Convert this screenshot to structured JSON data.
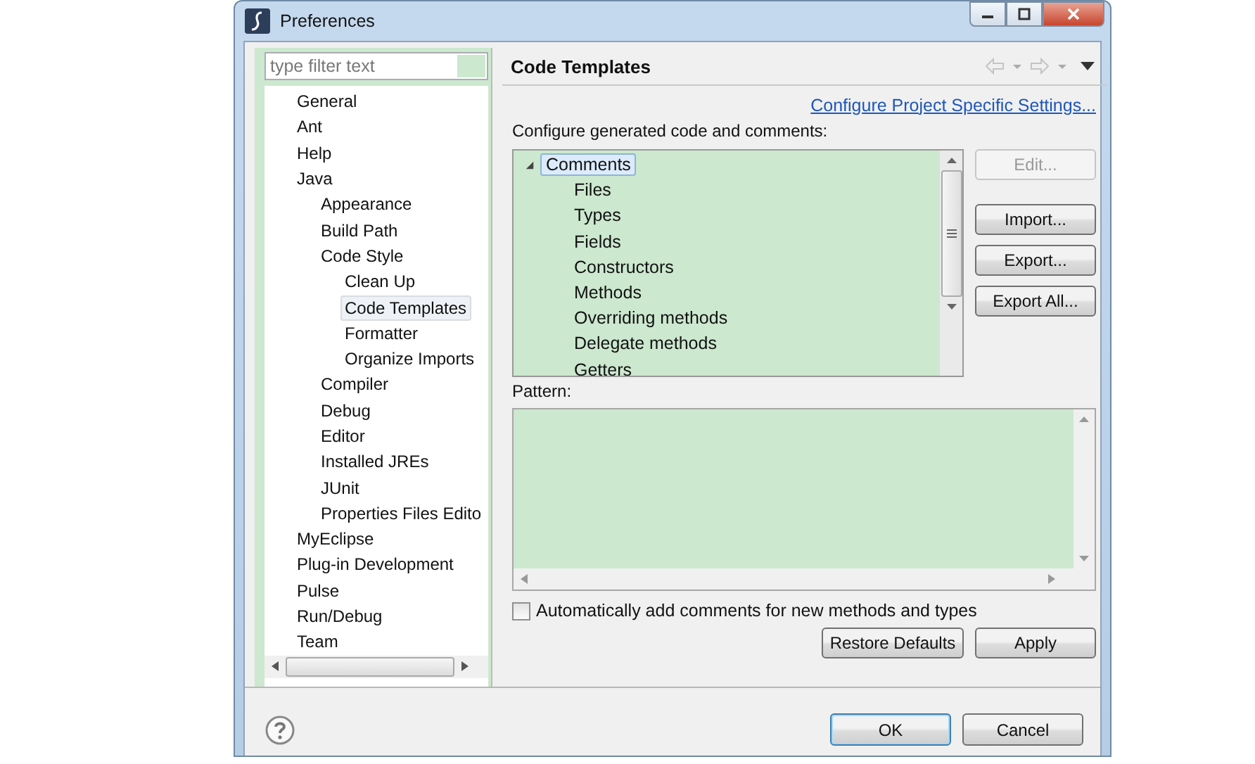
{
  "window": {
    "title": "Preferences"
  },
  "filter": {
    "placeholder": "type filter text"
  },
  "nav_tree": [
    {
      "label": "General",
      "selected": false
    },
    {
      "label": "Ant",
      "selected": false
    },
    {
      "label": "Help",
      "selected": false
    },
    {
      "label": "Java",
      "selected": false,
      "children": [
        {
          "label": "Appearance",
          "selected": false
        },
        {
          "label": "Build Path",
          "selected": false
        },
        {
          "label": "Code Style",
          "selected": false,
          "children": [
            {
              "label": "Clean Up",
              "selected": false
            },
            {
              "label": "Code Templates",
              "selected": true
            },
            {
              "label": "Formatter",
              "selected": false
            },
            {
              "label": "Organize Imports",
              "selected": false
            }
          ]
        },
        {
          "label": "Compiler",
          "selected": false
        },
        {
          "label": "Debug",
          "selected": false
        },
        {
          "label": "Editor",
          "selected": false
        },
        {
          "label": "Installed JREs",
          "selected": false
        },
        {
          "label": "JUnit",
          "selected": false
        },
        {
          "label": "Properties Files Edito",
          "selected": false
        }
      ]
    },
    {
      "label": "MyEclipse",
      "selected": false
    },
    {
      "label": "Plug-in Development",
      "selected": false
    },
    {
      "label": "Pulse",
      "selected": false
    },
    {
      "label": "Run/Debug",
      "selected": false
    },
    {
      "label": "Team",
      "selected": false
    }
  ],
  "page": {
    "title": "Code Templates",
    "link": "Configure Project Specific Settings...",
    "intro": "Configure generated code and comments:",
    "templates": [
      {
        "label": "Comments",
        "selected": true,
        "expanded": true,
        "children": [
          {
            "label": "Files",
            "selected": false
          },
          {
            "label": "Types",
            "selected": false
          },
          {
            "label": "Fields",
            "selected": false
          },
          {
            "label": "Constructors",
            "selected": false
          },
          {
            "label": "Methods",
            "selected": false
          },
          {
            "label": "Overriding methods",
            "selected": false
          },
          {
            "label": "Delegate methods",
            "selected": false
          },
          {
            "label": "Getters",
            "selected": false
          }
        ]
      }
    ],
    "side_buttons": [
      {
        "label": "Edit...",
        "disabled": true
      },
      {
        "label": "Import...",
        "disabled": false
      },
      {
        "label": "Export...",
        "disabled": false
      },
      {
        "label": "Export All...",
        "disabled": false
      }
    ],
    "pattern_label": "Pattern:",
    "auto_comments": {
      "label": "Automatically add comments for new methods and types",
      "checked": false
    },
    "buttons": [
      "Restore Defaults",
      "Apply"
    ]
  },
  "dialog_buttons": [
    {
      "label": "OK",
      "default": true
    },
    {
      "label": "Cancel",
      "default": false
    }
  ]
}
